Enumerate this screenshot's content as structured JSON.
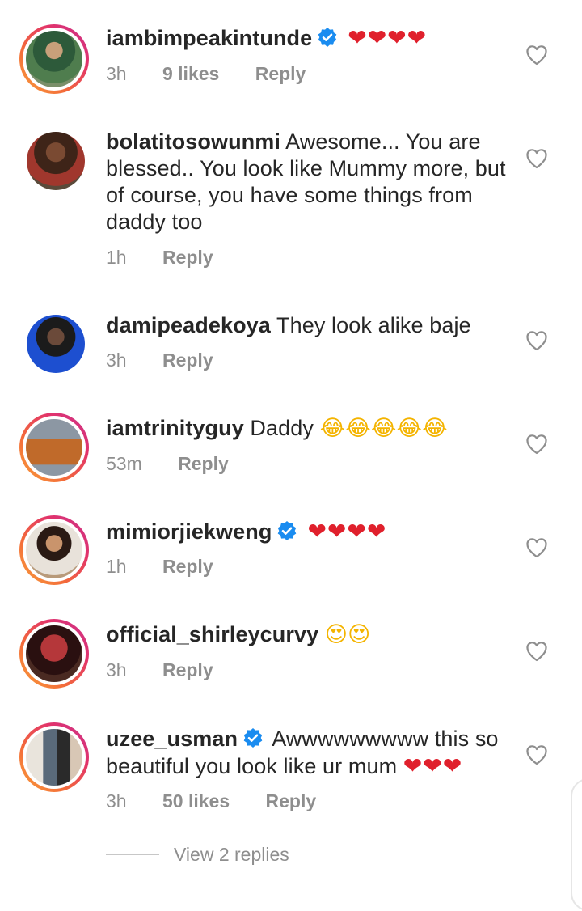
{
  "colors": {
    "verified_blue": "#1a8cf0",
    "heart_red": "#e0202c",
    "meta_gray": "#8e8e8e"
  },
  "icons": {
    "like": "heart-outline-icon",
    "verified": "verified-badge-icon"
  },
  "comments": [
    {
      "username": "iambimpeakintunde",
      "verified": true,
      "text": "",
      "emoji": "❤❤❤❤",
      "time": "3h",
      "likes": "9 likes",
      "reply": "Reply"
    },
    {
      "username": "bolatitosowunmi",
      "verified": false,
      "text": " Awesome... You are blessed.. You look like Mummy more, but of course, you have some things from daddy too",
      "emoji": "",
      "time": "1h",
      "likes": "",
      "reply": "Reply"
    },
    {
      "username": "damipeadekoya",
      "verified": false,
      "text": " They look alike baje",
      "emoji": "",
      "time": "3h",
      "likes": "",
      "reply": "Reply"
    },
    {
      "username": "iamtrinityguy",
      "verified": false,
      "text": " Daddy ",
      "emoji": "😂😂😂😂😂",
      "time": "53m",
      "likes": "",
      "reply": "Reply"
    },
    {
      "username": "mimiorjiekweng",
      "verified": true,
      "text": "",
      "emoji": "❤❤❤❤",
      "time": "1h",
      "likes": "",
      "reply": "Reply"
    },
    {
      "username": "official_shirleycurvy",
      "verified": false,
      "text": " ",
      "emoji": "😍😍",
      "time": "3h",
      "likes": "",
      "reply": "Reply"
    },
    {
      "username": "uzee_usman",
      "verified": true,
      "text": " Awwwwwwwww this so beautiful you look like ur mum ",
      "emoji": "❤❤❤",
      "time": "3h",
      "likes": "50 likes",
      "reply": "Reply"
    }
  ],
  "view_replies": "View 2 replies"
}
